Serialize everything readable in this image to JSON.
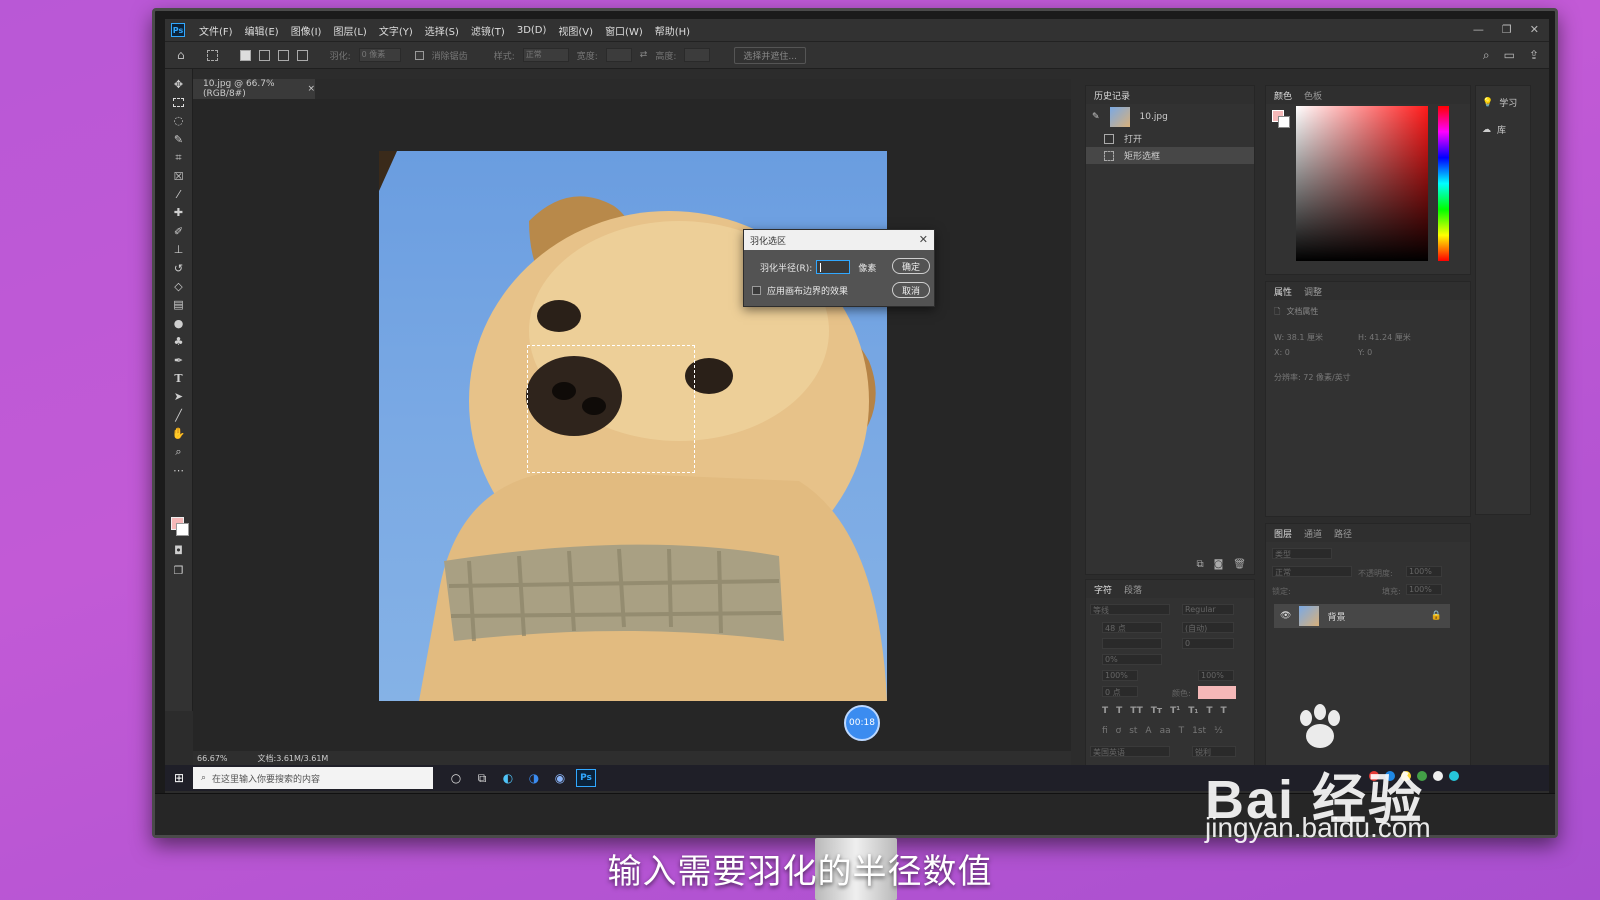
{
  "menubar": {
    "items": [
      "文件(F)",
      "编辑(E)",
      "图像(I)",
      "图层(L)",
      "文字(Y)",
      "选择(S)",
      "滤镜(T)",
      "3D(D)",
      "视图(V)",
      "窗口(W)",
      "帮助(H)"
    ]
  },
  "options_bar": {
    "feather_label": "羽化:",
    "feather_value": "0 像素",
    "antialias_label": "消除锯齿",
    "style_label": "样式:",
    "style_value": "正常",
    "width_label": "宽度:",
    "height_label": "高度:",
    "select_mask_button": "选择并遮住..."
  },
  "document": {
    "tab_title": "10.jpg @ 66.7%(RGB/8#)",
    "zoom": "66.67%",
    "doc_size": "文档:3.61M/3.61M"
  },
  "dialog": {
    "title": "羽化选区",
    "radius_label": "羽化半径(R):",
    "unit": "像素",
    "ok_button": "确定",
    "cancel_button": "取消",
    "checkbox_label": "应用画布边界的效果"
  },
  "timer": "00:18",
  "history_panel": {
    "title": "历史记录",
    "snapshot": "10.jpg",
    "items": [
      "打开",
      "矩形选框"
    ]
  },
  "color_panel": {
    "tabs": [
      "颜色",
      "色板"
    ]
  },
  "learn_panel": {
    "items": [
      "学习",
      "库"
    ]
  },
  "properties_panel": {
    "tabs": [
      "属性",
      "调整"
    ],
    "doc_props": "文档属性",
    "w": "W: 38.1 厘米",
    "h": "H: 41.24 厘米",
    "x": "X: 0",
    "y": "Y: 0",
    "resolution": "分辨率: 72 像素/英寸"
  },
  "layers_panel": {
    "tabs": [
      "图层",
      "通道",
      "路径"
    ],
    "kind_filter": "类型",
    "blend_mode": "正常",
    "opacity_label": "不透明度:",
    "opacity_value": "100%",
    "lock_label": "锁定:",
    "fill_label": "填充:",
    "fill_value": "100%",
    "layer_name": "背景"
  },
  "character_panel": {
    "tabs": [
      "字符",
      "段落"
    ],
    "font": "等线",
    "style": "Regular",
    "size": "48 点",
    "leading": "(自动)",
    "tracking": "0",
    "scale_v": "100%",
    "scale_h": "100%",
    "baseline": "0 点",
    "color_label": "颜色:",
    "percent": "0%",
    "language": "美国英语",
    "aa": "锐利"
  },
  "taskbar": {
    "search_placeholder": "在这里输入你要搜索的内容"
  },
  "subtitle": "输入需要羽化的半径数值",
  "watermark": {
    "logo": "Bai 经验",
    "url": "jingyan.baidu.com"
  }
}
